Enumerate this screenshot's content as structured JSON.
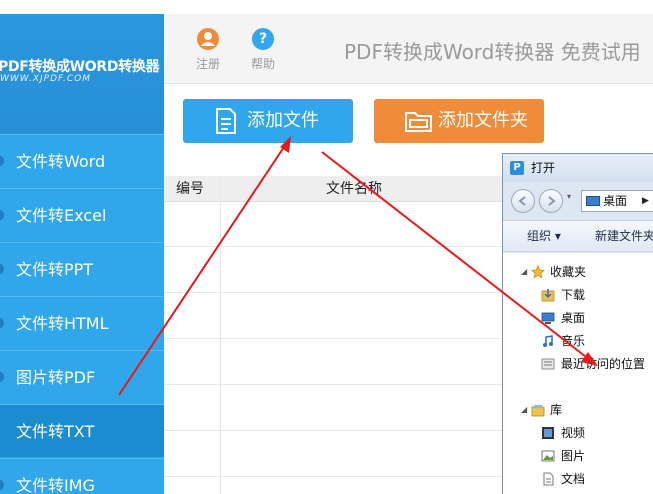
{
  "sidebar": {
    "logo_main": "PDF转换成WORD转换器",
    "logo_sub": "WWW.XJPDF.COM",
    "items": [
      {
        "label": "文件转Word"
      },
      {
        "label": "文件转Excel"
      },
      {
        "label": "文件转PPT"
      },
      {
        "label": "文件转HTML"
      },
      {
        "label": "图片转PDF"
      },
      {
        "label": "文件转TXT"
      },
      {
        "label": "文件转IMG"
      }
    ]
  },
  "toolbar": {
    "register_label": "注册",
    "help_label": "帮助",
    "app_title": "PDF转换成Word转换器 免费试用"
  },
  "buttons": {
    "add_file": "添加文件",
    "add_folder": "添加文件夹"
  },
  "table": {
    "headers": [
      "编号",
      "文件名称"
    ]
  },
  "dialog": {
    "title": "打开",
    "address": "桌面",
    "organize": "组织 ▾",
    "new_folder": "新建文件夹",
    "tree": [
      {
        "label": "收藏夹",
        "icon": "star-icon"
      },
      {
        "label": "下载",
        "icon": "download-folder-icon"
      },
      {
        "label": "桌面",
        "icon": "desktop-icon"
      },
      {
        "label": "音乐",
        "icon": "music-icon"
      },
      {
        "label": "最近访问的位置",
        "icon": "recent-places-icon"
      },
      {
        "label": "库",
        "icon": "library-icon"
      },
      {
        "label": "视频",
        "icon": "video-icon"
      },
      {
        "label": "图片",
        "icon": "pictures-icon"
      },
      {
        "label": "文档",
        "icon": "documents-icon"
      }
    ]
  },
  "colors": {
    "sidebar": "#2ea3e6",
    "sidebar_active": "#1a8ccf",
    "add_file_button": "#2fa6ee",
    "add_folder_button": "#f08b3a",
    "register_icon": "#f08b3a",
    "help_icon": "#2fa6ee",
    "annotation_arrow": "#e8191a"
  }
}
